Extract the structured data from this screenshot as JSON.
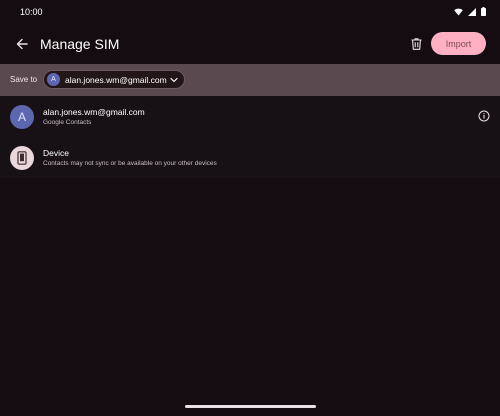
{
  "status_bar": {
    "time": "10:00",
    "icons": [
      "wifi-icon",
      "signal-icon",
      "battery-icon"
    ]
  },
  "app_bar": {
    "title": "Manage SIM",
    "back_icon": "arrow-back-icon",
    "delete_icon": "trash-icon",
    "import_label": "Import"
  },
  "save_to": {
    "label": "Save to",
    "account_initial": "A",
    "account_email": "alan.jones.wm@gmail.com"
  },
  "destinations": [
    {
      "initial": "A",
      "title": "alan.jones.wm@gmail.com",
      "subtitle": "Google Contacts"
    },
    {
      "title": "Device",
      "subtitle": "Contacts may not sync or be available on your other devices"
    }
  ],
  "colors": {
    "background": "#140c10",
    "accent": "#ffb1c3",
    "account_avatar": "#5c67b0",
    "band": "#5a4a50"
  }
}
